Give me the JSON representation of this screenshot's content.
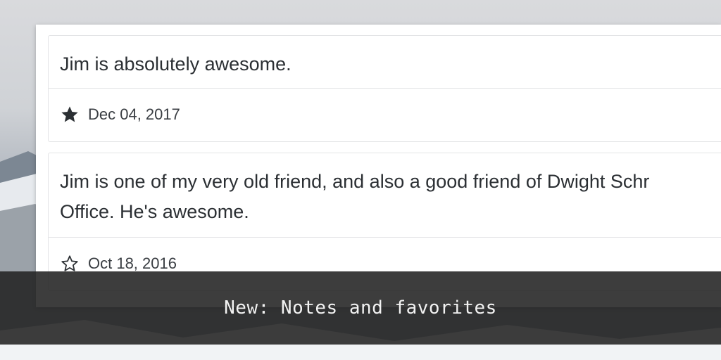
{
  "notes": [
    {
      "text": "Jim is absolutely awesome.",
      "date": "Dec 04, 2017",
      "favorite": true
    },
    {
      "text_line1": "Jim is one of my very old friend, and also a good friend of Dwight Schr",
      "text_line2": "Office. He's awesome.",
      "date": "Oct 18, 2016",
      "favorite": false
    }
  ],
  "caption": "New: Notes and favorites",
  "icons": {
    "favorite_filled": "star-filled-icon",
    "favorite_empty": "star-outline-icon"
  },
  "colors": {
    "text": "#2b2f33",
    "star": "#2b2f33",
    "caption_bg": "#222222",
    "caption_text": "#f2f2f2"
  }
}
